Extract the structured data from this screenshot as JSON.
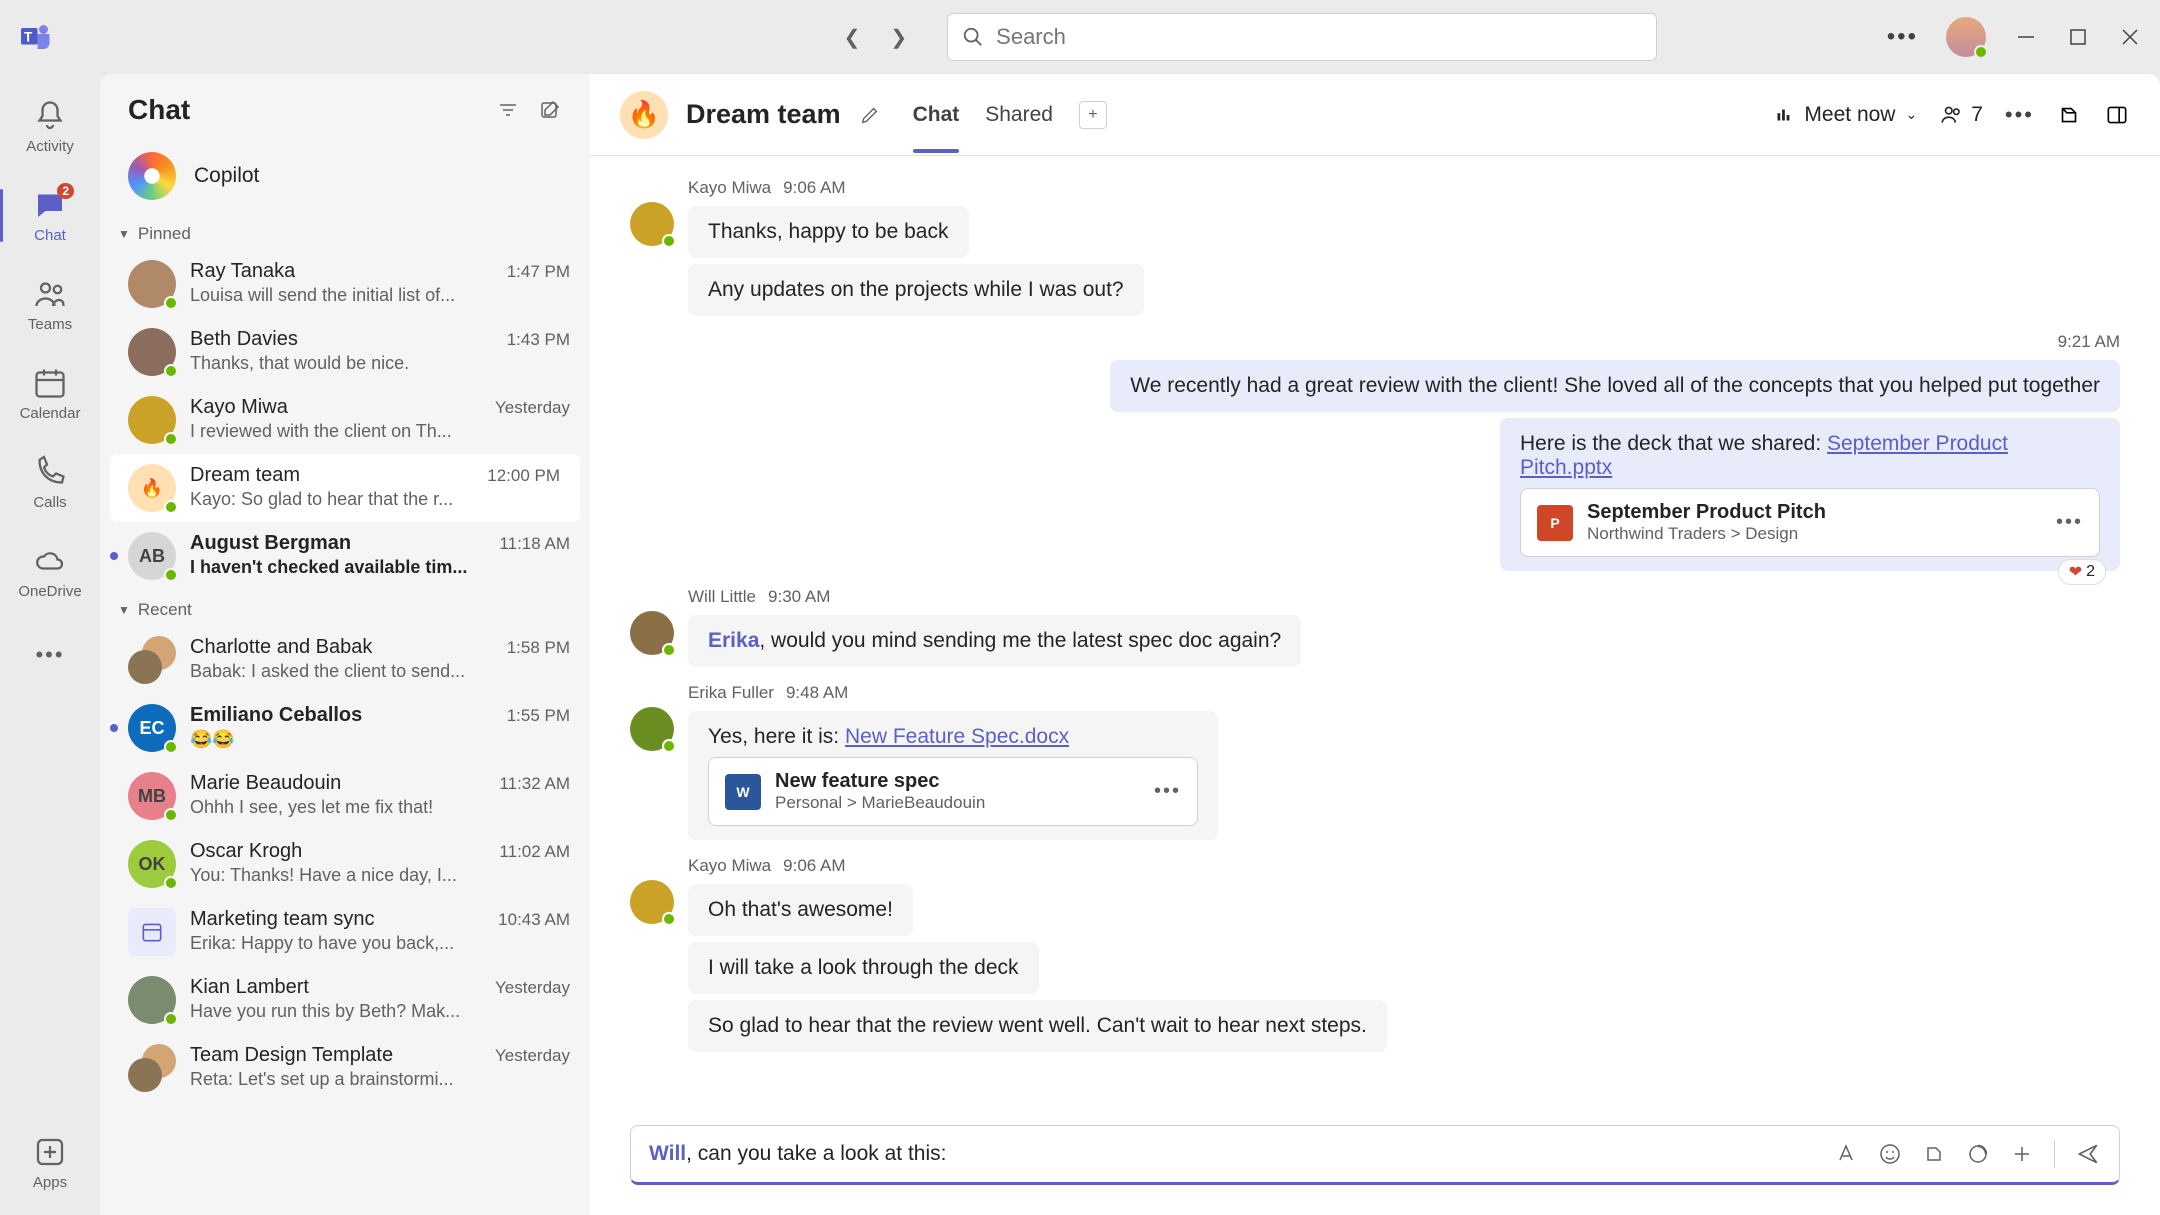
{
  "search": {
    "placeholder": "Search"
  },
  "rail": {
    "badge": "2",
    "items": [
      "Activity",
      "Chat",
      "Teams",
      "Calendar",
      "Calls",
      "OneDrive"
    ],
    "apps": "Apps"
  },
  "chatlist": {
    "title": "Chat",
    "copilot": "Copilot",
    "sections": {
      "pinned": "Pinned",
      "recent": "Recent"
    },
    "pinned": [
      {
        "name": "Ray Tanaka",
        "time": "1:47 PM",
        "preview": "Louisa will send the initial list of...",
        "initials": "",
        "bg": "#b08968"
      },
      {
        "name": "Beth Davies",
        "time": "1:43 PM",
        "preview": "Thanks, that would be nice.",
        "initials": "",
        "bg": "#8a6d5c"
      },
      {
        "name": "Kayo Miwa",
        "time": "Yesterday",
        "preview": "I reviewed with the client on Th...",
        "initials": "",
        "bg": "#c9a227"
      },
      {
        "name": "Dream team",
        "time": "12:00 PM",
        "preview": "Kayo: So glad to hear that the r...",
        "initials": "🔥",
        "bg": "#ffe0b2",
        "selected": true
      },
      {
        "name": "August Bergman",
        "time": "11:18 AM",
        "preview": "I haven't checked available tim...",
        "initials": "AB",
        "bg": "#d6d6d6",
        "unread": true
      }
    ],
    "recent": [
      {
        "name": "Charlotte and Babak",
        "time": "1:58 PM",
        "preview": "Babak: I asked the client to send...",
        "pair": true
      },
      {
        "name": "Emiliano Ceballos",
        "time": "1:55 PM",
        "preview": "😂😂",
        "initials": "EC",
        "bg": "#0f6cbd",
        "fg": "#fff",
        "unread": true
      },
      {
        "name": "Marie Beaudouin",
        "time": "11:32 AM",
        "preview": "Ohhh I see, yes let me fix that!",
        "initials": "MB",
        "bg": "#e6808a"
      },
      {
        "name": "Oscar Krogh",
        "time": "11:02 AM",
        "preview": "You: Thanks! Have a nice day, I...",
        "initials": "OK",
        "bg": "#9ccc3c"
      },
      {
        "name": "Marketing team sync",
        "time": "10:43 AM",
        "preview": "Erika: Happy to have you back,...",
        "cal": true
      },
      {
        "name": "Kian Lambert",
        "time": "Yesterday",
        "preview": "Have you run this by Beth? Mak...",
        "initials": "",
        "bg": "#7a8b6f"
      },
      {
        "name": "Team Design Template",
        "time": "Yesterday",
        "preview": "Reta: Let's set up a brainstormi...",
        "pair": true
      }
    ]
  },
  "convo": {
    "title": "Dream team",
    "tabs": [
      "Chat",
      "Shared"
    ],
    "meet": "Meet now",
    "people": "7"
  },
  "messages": {
    "m1_meta_name": "Kayo Miwa",
    "m1_meta_time": "9:06 AM",
    "m1a": "Thanks, happy to be back",
    "m1b": "Any updates on the projects while I was out?",
    "m2_time": "9:21 AM",
    "m2a": "We recently had a great review with the client! She loved all of the concepts that you helped put together",
    "m2b_pre": "Here is the deck that we shared: ",
    "m2b_link": "September Product Pitch.pptx",
    "att1_name": "September Product Pitch",
    "att1_path": "Northwind Traders > Design",
    "reaction_count": "2",
    "m3_name": "Will Little",
    "m3_time": "9:30 AM",
    "m3_mention": "Erika",
    "m3_text": ", would you mind sending me the latest spec doc again?",
    "m4_name": "Erika Fuller",
    "m4_time": "9:48 AM",
    "m4_pre": "Yes, here it is: ",
    "m4_link": "New Feature Spec.docx",
    "att2_name": "New feature spec",
    "att2_path": "Personal > MarieBeaudouin",
    "m5_name": "Kayo Miwa",
    "m5_time": "9:06 AM",
    "m5a": "Oh that's awesome!",
    "m5b": "I will take a look through the deck",
    "m5c": "So glad to hear that the review went well. Can't wait to hear next steps."
  },
  "composer": {
    "mention": "Will",
    "text": ", can you take a look at this:"
  }
}
